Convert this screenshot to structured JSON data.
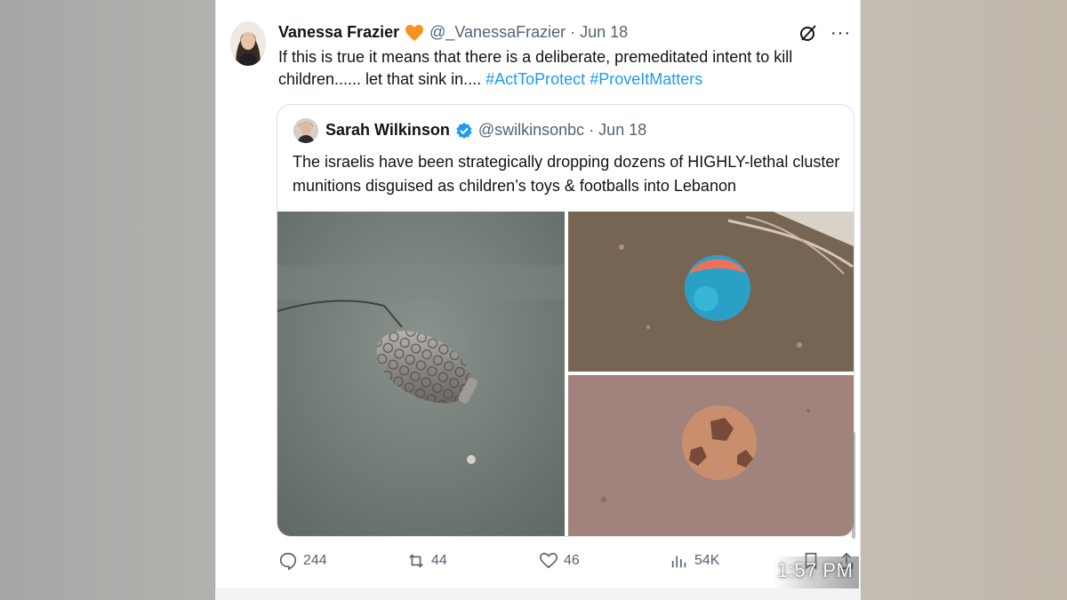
{
  "tweet": {
    "author_name": "Vanessa Frazier",
    "author_handle": "@_VanessaFrazier · Jun 18",
    "badge_icon": "orange-heart-icon",
    "text_main": "If this is true it means that there is a deliberate, premeditated intent to kill children...... let that sink in.... ",
    "hashtags": [
      "#ActToProtect",
      "#ProveItMatters"
    ],
    "more_label": "···"
  },
  "quote": {
    "author_name": "Sarah Wilkinson",
    "author_handle": "@swilkinsonbc · Jun 18",
    "badge_icon": "verified-icon",
    "text": "The israelis have been strategically dropping dozens of HIGHLY-lethal cluster munitions disguised as children’s toys & footballs into Lebanon"
  },
  "actions": {
    "replies": "244",
    "reposts": "44",
    "likes": "46",
    "views": "54K"
  },
  "status": {
    "time": "1:57 PM"
  },
  "colors": {
    "link": "#1d9bf0",
    "text": "#0f1419",
    "muted": "#536471",
    "heart": "#f7931e"
  }
}
